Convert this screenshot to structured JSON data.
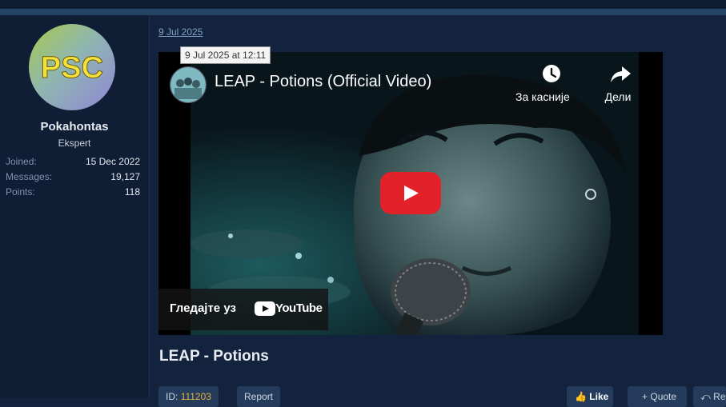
{
  "post": {
    "date_label": "9 Jul 2025",
    "tooltip": "9 Jul 2025 at 12:11",
    "text": "LEAP - Potions"
  },
  "user": {
    "avatar_text": "PSC",
    "name": "Pokahontas",
    "title": "Ekspert",
    "stats": [
      {
        "key": "Joined:",
        "value": "15 Dec 2022"
      },
      {
        "key": "Messages:",
        "value": "19,127"
      },
      {
        "key": "Points:",
        "value": "118"
      }
    ]
  },
  "video": {
    "title": "LEAP - Potions (Official Video)",
    "watch_later": "За касније",
    "share": "Дели",
    "watch_on": "Гледајте уз",
    "platform": "YouTube"
  },
  "footer": {
    "id_label": "ID:",
    "id_value": "111203",
    "report": "Report",
    "like": "Like",
    "quote": "Quote",
    "reply": "Re"
  },
  "colors": {
    "background": "#13233d",
    "sidebar": "#0f1e35",
    "avatar_text": "#f4e23a",
    "play_button": "#e32128"
  }
}
